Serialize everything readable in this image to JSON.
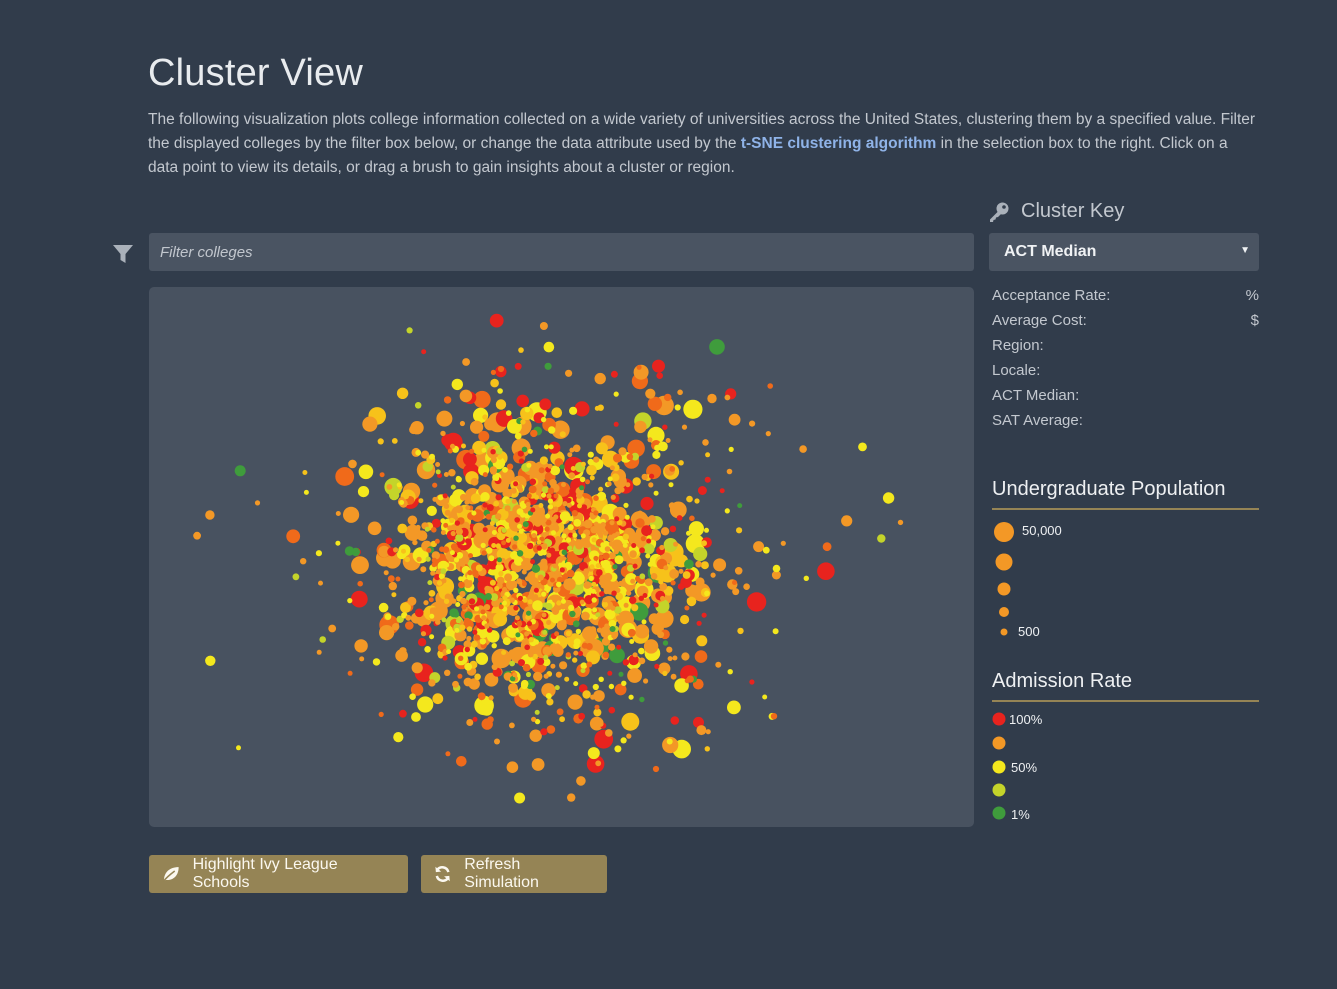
{
  "header": {
    "title": "Cluster View",
    "intro_1": "The following visualization plots college information collected on a wide variety of universities across the United States, clustering them by a specified value. Filter the displayed colleges by the filter box below, or change the data attribute used by the ",
    "intro_link": "t-SNE clustering algorithm",
    "intro_2": " in the selection box to the right. Click on a data point to view its details, or drag a brush to gain insights about a cluster or region."
  },
  "filter": {
    "placeholder": "Filter colleges",
    "value": ""
  },
  "cluster_key": {
    "label": "Cluster Key",
    "selected": "ACT Median"
  },
  "details": [
    {
      "label": "Acceptance Rate:",
      "unit": "%"
    },
    {
      "label": "Average Cost:",
      "unit": "$"
    },
    {
      "label": "Region:",
      "unit": ""
    },
    {
      "label": "Locale:",
      "unit": ""
    },
    {
      "label": "ACT Median:",
      "unit": ""
    },
    {
      "label": "SAT Average:",
      "unit": ""
    }
  ],
  "legend_population": {
    "title": "Undergraduate Population",
    "max_label": "50,000",
    "min_label": "500"
  },
  "legend_admission": {
    "title": "Admission Rate",
    "labels": [
      "100%",
      "",
      "50%",
      "",
      "1%"
    ],
    "colors": [
      "#e8231e",
      "#f39826",
      "#f4e81d",
      "#c4d42a",
      "#3f9c3c"
    ]
  },
  "buttons": {
    "ivy": "Highlight Ivy League Schools",
    "refresh": "Refresh Simulation"
  },
  "scatter": {
    "palette": [
      "#e8231e",
      "#f06a1a",
      "#f39826",
      "#f7c21a",
      "#f4e81d",
      "#c4d42a",
      "#3f9c3c"
    ],
    "legend_size_color": "#f39826"
  }
}
